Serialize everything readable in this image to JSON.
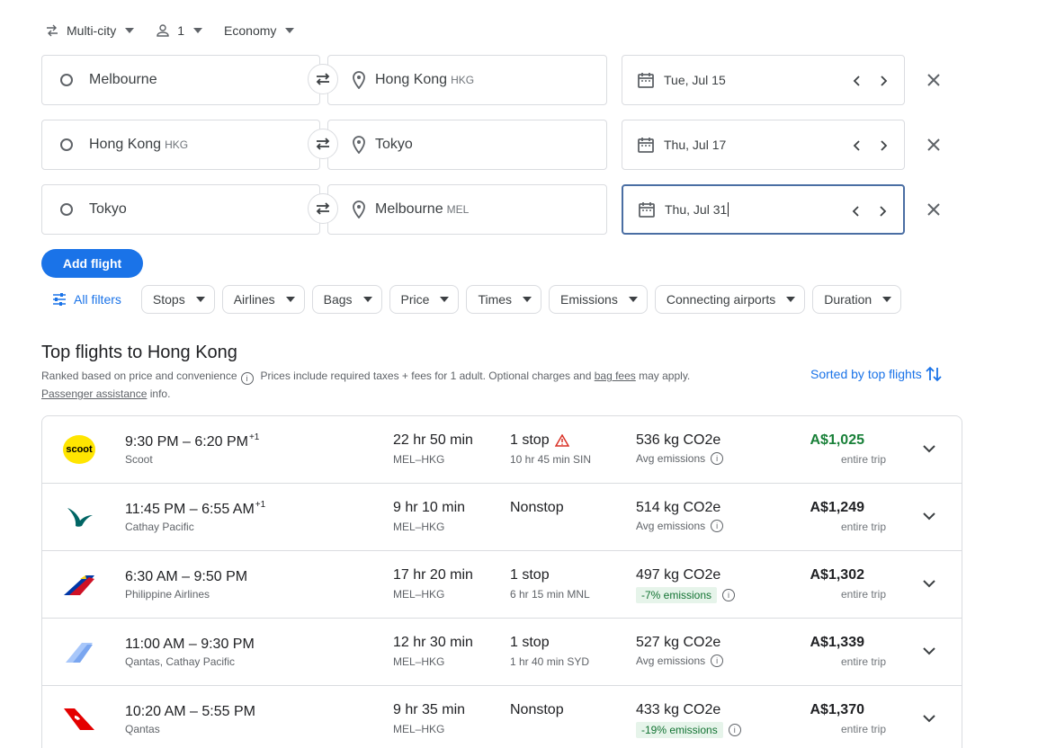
{
  "search": {
    "trip_type": "Multi-city",
    "passengers": "1",
    "cabin": "Economy",
    "legs": [
      {
        "origin": "Melbourne",
        "origin_code": "",
        "destination": "Hong Kong",
        "destination_code": "HKG",
        "date": "Tue, Jul 15"
      },
      {
        "origin": "Hong Kong",
        "origin_code": "HKG",
        "destination": "Tokyo",
        "destination_code": "",
        "date": "Thu, Jul 17"
      },
      {
        "origin": "Tokyo",
        "origin_code": "",
        "destination": "Melbourne",
        "destination_code": "MEL",
        "date": "Thu, Jul 31"
      }
    ],
    "add_flight_label": "Add flight"
  },
  "filters": {
    "all_filters_label": "All filters",
    "chips": [
      "Stops",
      "Airlines",
      "Bags",
      "Price",
      "Times",
      "Emissions",
      "Connecting airports",
      "Duration"
    ]
  },
  "results": {
    "title": "Top flights to Hong Kong",
    "ranked_text": "Ranked based on price and convenience",
    "prices_text": "Prices include required taxes + fees for 1 adult. Optional charges and",
    "bag_fees_link": "bag fees",
    "may_apply": "may apply.",
    "passenger_assistance_link": "Passenger assistance",
    "info_suffix": "info.",
    "sorted_label": "Sorted by top flights",
    "flights": [
      {
        "times": "9:30 PM – 6:20 PM",
        "day_offset": "+1",
        "airline": "Scoot",
        "logo": "scoot-logo",
        "duration": "22 hr 50 min",
        "route": "MEL–HKG",
        "stops": "1 stop",
        "layover": "10 hr 45 min SIN",
        "emissions": "536 kg CO2e",
        "emissions_note": "Avg emissions",
        "price": "A$1,025",
        "price_note": "entire trip"
      },
      {
        "times": "11:45 PM – 6:55 AM",
        "day_offset": "+1",
        "airline": "Cathay Pacific",
        "logo": "cathay-pacific-logo",
        "duration": "9 hr 10 min",
        "route": "MEL–HKG",
        "stops": "Nonstop",
        "layover": "",
        "emissions": "514 kg CO2e",
        "emissions_note": "Avg emissions",
        "price": "A$1,249",
        "price_note": "entire trip"
      },
      {
        "times": "6:30 AM – 9:50 PM",
        "day_offset": "",
        "airline": "Philippine Airlines",
        "logo": "philippine-airlines-logo",
        "duration": "17 hr 20 min",
        "route": "MEL–HKG",
        "stops": "1 stop",
        "layover": "6 hr 15 min MNL",
        "emissions": "497 kg CO2e",
        "emissions_note": "-7% emissions",
        "price": "A$1,302",
        "price_note": "entire trip"
      },
      {
        "times": "11:00 AM – 9:30 PM",
        "day_offset": "",
        "airline": "Qantas, Cathay Pacific",
        "logo": "multi-airline-logo",
        "duration": "12 hr 30 min",
        "route": "MEL–HKG",
        "stops": "1 stop",
        "layover": "1 hr 40 min SYD",
        "emissions": "527 kg CO2e",
        "emissions_note": "Avg emissions",
        "price": "A$1,339",
        "price_note": "entire trip"
      },
      {
        "times": "10:20 AM – 5:55 PM",
        "day_offset": "",
        "airline": "Qantas",
        "logo": "qantas-logo",
        "duration": "9 hr 35 min",
        "route": "MEL–HKG",
        "stops": "Nonstop",
        "layover": "",
        "emissions": "433 kg CO2e",
        "emissions_note": "-19% emissions",
        "price": "A$1,370",
        "price_note": "entire trip"
      }
    ]
  },
  "colors": {
    "accent": "#1a73e8",
    "cheapest_price": "#188038",
    "emissions_badge_bg": "#e6f4ea",
    "warning": "#d93025"
  }
}
